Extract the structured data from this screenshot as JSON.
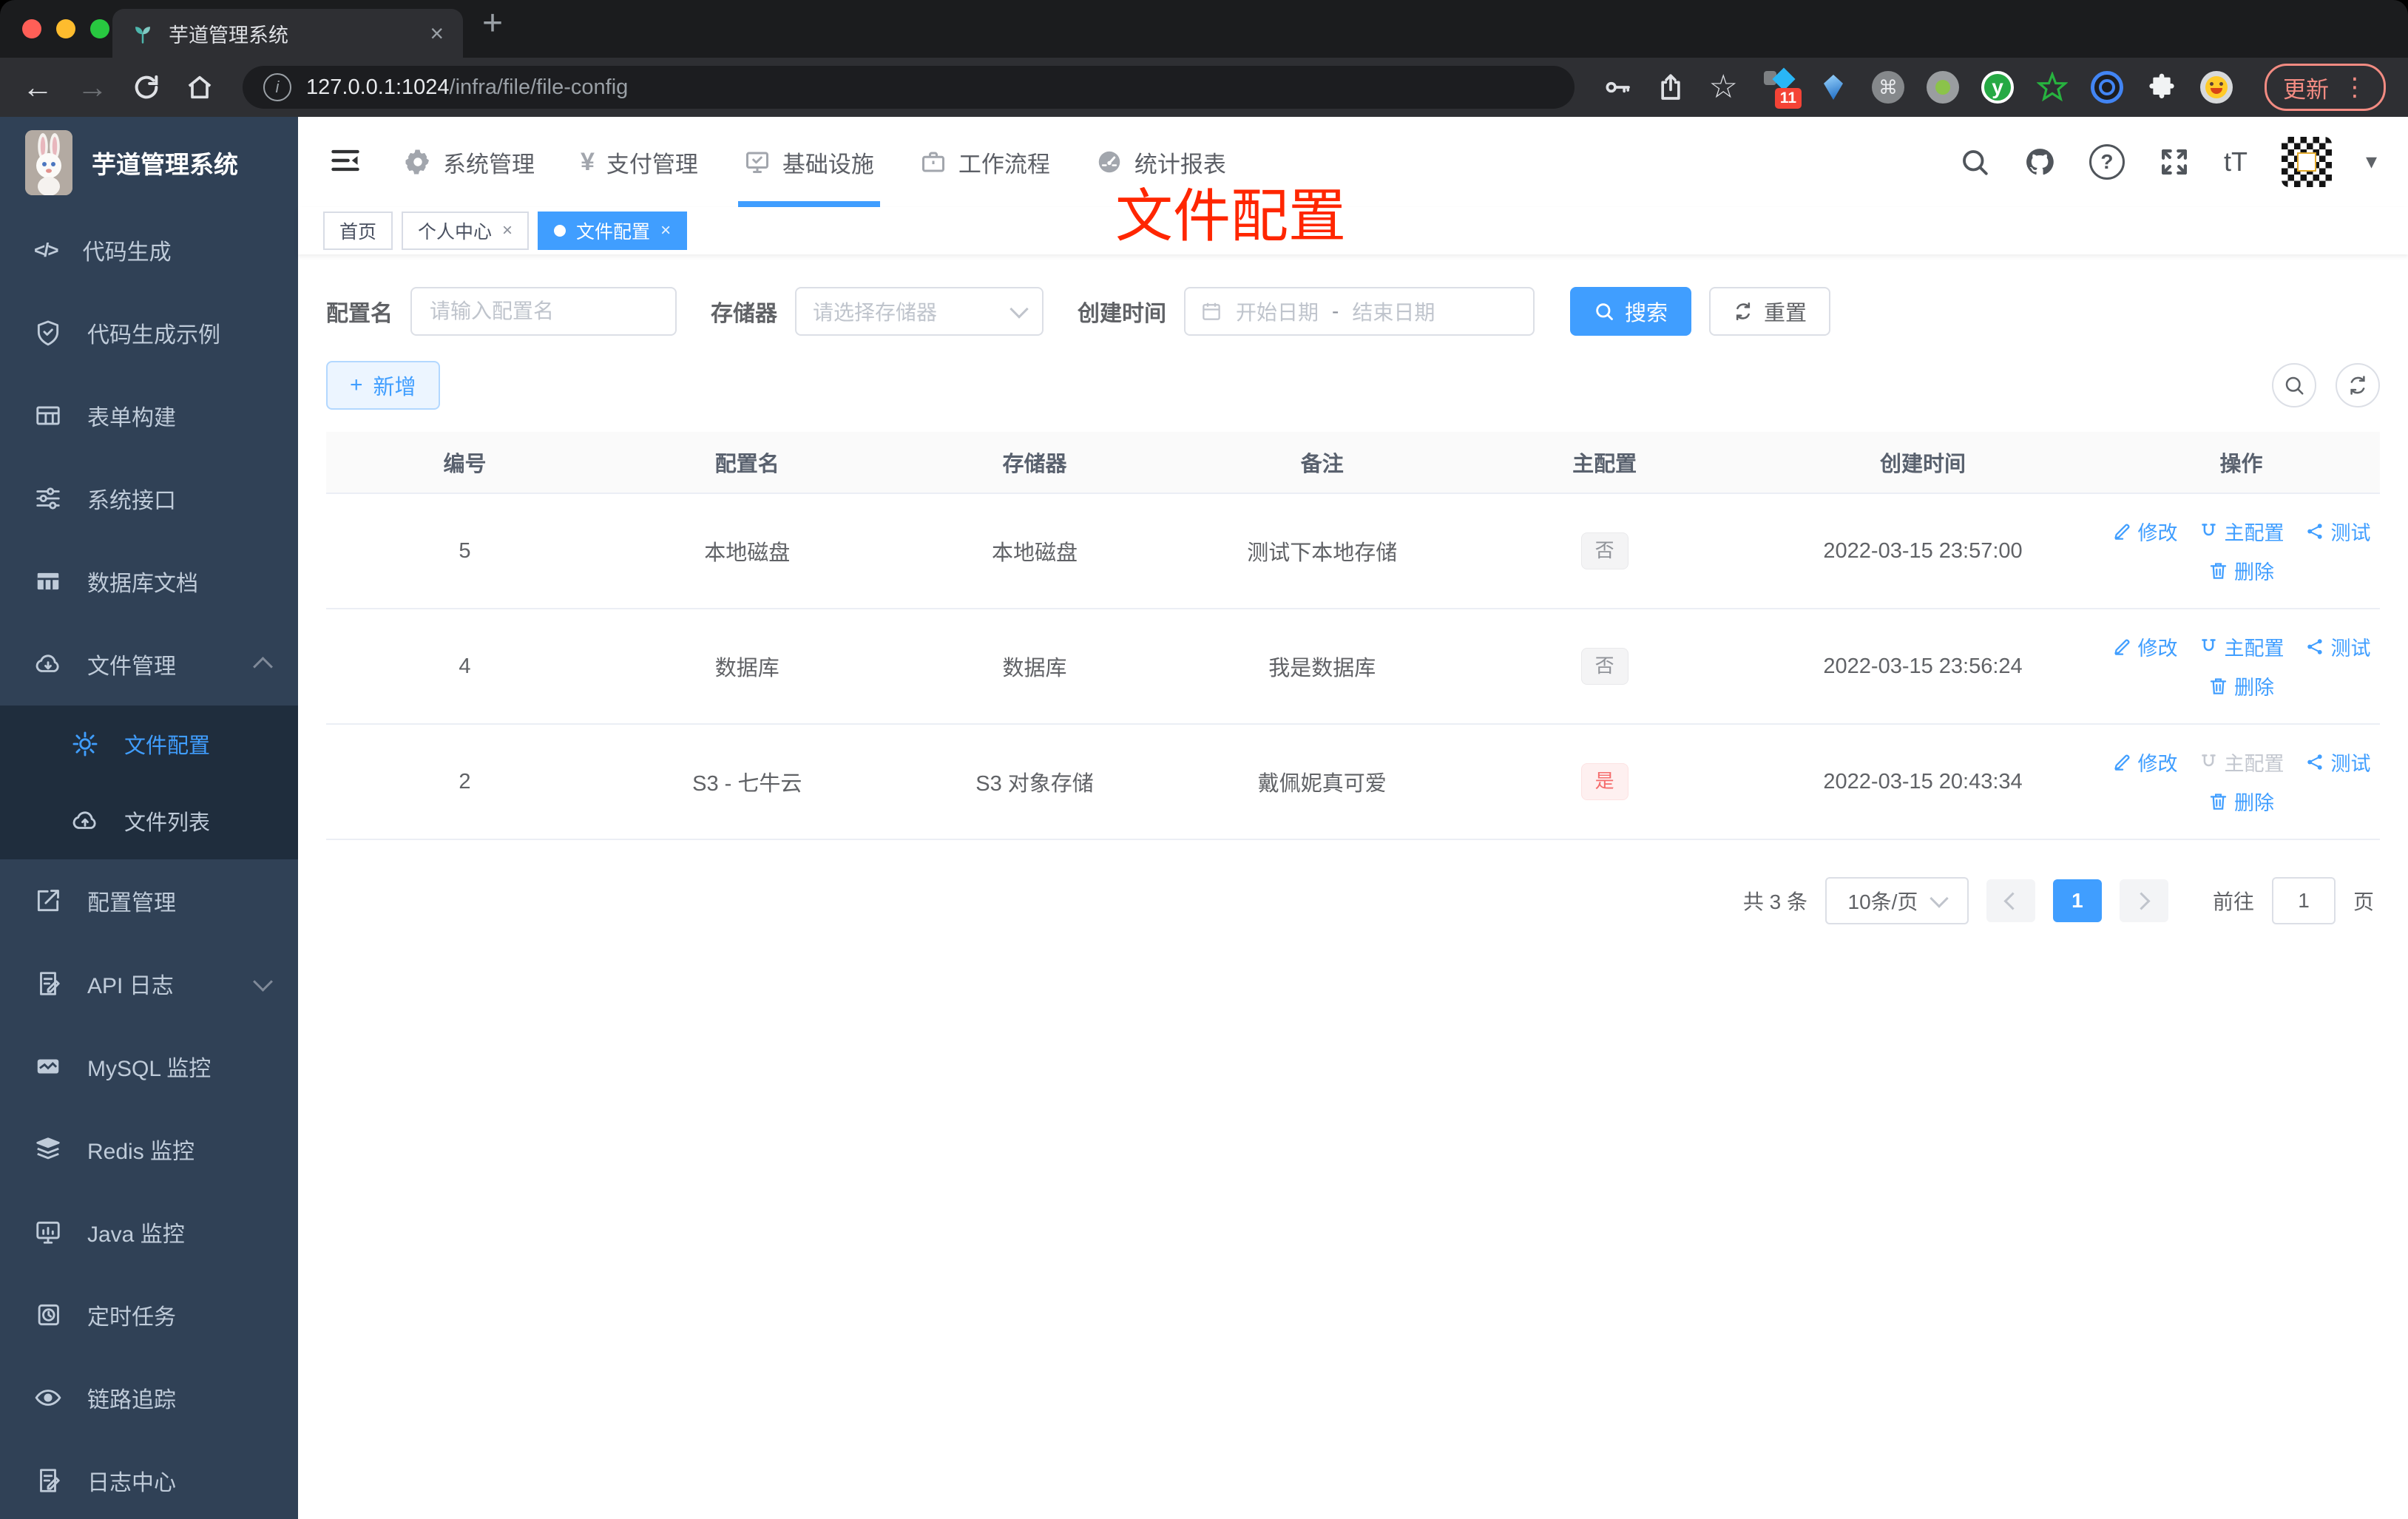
{
  "colors": {
    "accent": "#409eff",
    "sidebar_bg": "#304156",
    "submenu_bg": "#1f2d3d",
    "danger": "#f56c6c",
    "annotation_red": "#ff2600",
    "info_badge_text": "#909399"
  },
  "browser": {
    "tab_title": "芋道管理系统",
    "url_host": "127.0.0.1:1024",
    "url_path": "/infra/file/file-config",
    "update_label": "更新",
    "extension_badge_count": "11",
    "extension_y_label": "y"
  },
  "sidebar": {
    "app_title": "芋道管理系统",
    "items": [
      "代码生成",
      "代码生成示例",
      "表单构建",
      "系统接口",
      "数据库文档",
      "文件管理"
    ],
    "submenu": [
      "文件配置",
      "文件列表"
    ],
    "items2": [
      "配置管理",
      "API 日志",
      "MySQL 监控",
      "Redis 监控",
      "Java 监控",
      "定时任务",
      "链路追踪",
      "日志中心"
    ]
  },
  "topnav": {
    "items": [
      "系统管理",
      "支付管理",
      "基础设施",
      "工作流程",
      "统计报表"
    ]
  },
  "tags": {
    "home": "首页",
    "profile": "个人中心",
    "current": "文件配置"
  },
  "annotation": "文件配置",
  "filters": {
    "name_label": "配置名",
    "name_placeholder": "请输入配置名",
    "storage_label": "存储器",
    "storage_placeholder": "请选择存储器",
    "date_label": "创建时间",
    "date_start_placeholder": "开始日期",
    "date_separator": "-",
    "date_end_placeholder": "结束日期",
    "search_label": "搜索",
    "reset_label": "重置"
  },
  "actions_bar": {
    "add_label": "新增"
  },
  "table": {
    "headers": [
      "编号",
      "配置名",
      "存储器",
      "备注",
      "主配置",
      "创建时间",
      "操作"
    ],
    "row_actions": {
      "edit": "修改",
      "master": "主配置",
      "test": "测试",
      "delete": "删除"
    },
    "rows": [
      {
        "id": "5",
        "name": "本地磁盘",
        "storage": "本地磁盘",
        "remark": "测试下本地存储",
        "master": "否",
        "created": "2022-03-15 23:57:00"
      },
      {
        "id": "4",
        "name": "数据库",
        "storage": "数据库",
        "remark": "我是数据库",
        "master": "否",
        "created": "2022-03-15 23:56:24"
      },
      {
        "id": "2",
        "name": "S3 - 七牛云",
        "storage": "S3 对象存储",
        "remark": "戴佩妮真可爱",
        "master": "是",
        "created": "2022-03-15 20:43:34"
      }
    ]
  },
  "pagination": {
    "total": "共 3 条",
    "page_size": "10条/页",
    "current_page": "1",
    "goto_label": "前往",
    "goto_value": "1",
    "goto_unit": "页"
  }
}
